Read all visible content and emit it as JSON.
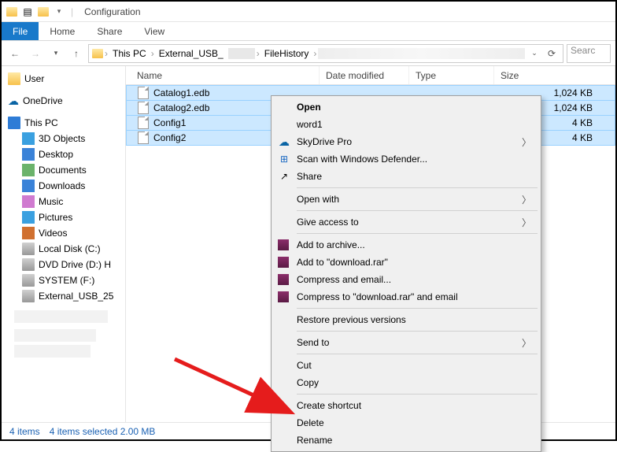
{
  "window": {
    "title": "Configuration"
  },
  "ribbon": {
    "file": "File",
    "home": "Home",
    "share": "Share",
    "view": "View"
  },
  "breadcrumb": [
    "This PC",
    "External_USB_",
    "",
    "FileHistory",
    ""
  ],
  "search_placeholder": "Searc",
  "tree": {
    "user": "User",
    "onedrive": "OneDrive",
    "thispc": "This PC",
    "items": [
      "3D Objects",
      "Desktop",
      "Documents",
      "Downloads",
      "Music",
      "Pictures",
      "Videos",
      "Local Disk (C:)",
      "DVD Drive (D:) H",
      "SYSTEM (F:)",
      "External_USB_25"
    ]
  },
  "columns": {
    "name": "Name",
    "date": "Date modified",
    "type": "Type",
    "size": "Size"
  },
  "files": [
    {
      "name": "Catalog1.edb",
      "date": "",
      "type": "",
      "size": "1,024 KB"
    },
    {
      "name": "Catalog2.edb",
      "date": "",
      "type": "",
      "size": "1,024 KB"
    },
    {
      "name": "Config1",
      "date": "",
      "type": "",
      "size": "4 KB"
    },
    {
      "name": "Config2",
      "date": "",
      "type": "",
      "size": "4 KB"
    }
  ],
  "context_menu": {
    "open": "Open",
    "word1": "word1",
    "skydrive": "SkyDrive Pro",
    "defender": "Scan with Windows Defender...",
    "share": "Share",
    "openwith": "Open with",
    "giveaccess": "Give access to",
    "addarchive": "Add to archive...",
    "addrar": "Add to \"download.rar\"",
    "compressemail": "Compress and email...",
    "compressraremail": "Compress to \"download.rar\" and email",
    "restore": "Restore previous versions",
    "sendto": "Send to",
    "cut": "Cut",
    "copy": "Copy",
    "shortcut": "Create shortcut",
    "delete": "Delete",
    "rename": "Rename"
  },
  "status": {
    "count": "4 items",
    "selection": "4 items selected  2.00 MB"
  }
}
